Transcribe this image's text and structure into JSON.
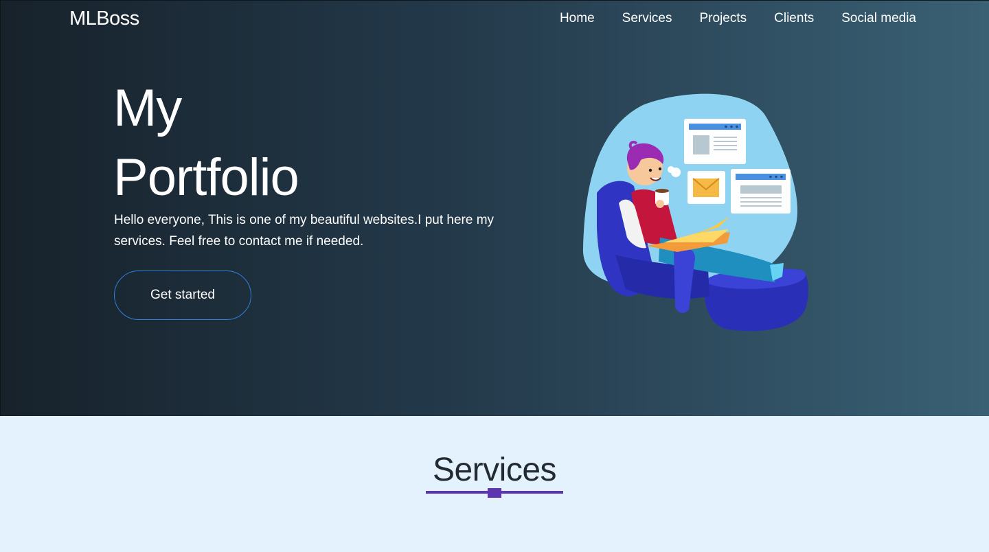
{
  "brand": "MLBoss",
  "nav": {
    "home": "Home",
    "services": "Services",
    "projects": "Projects",
    "clients": "Clients",
    "social": "Social media"
  },
  "hero": {
    "title_line1": "My",
    "title_line2": "Portfolio",
    "description": "Hello everyone, This is one of my beautiful websites.I put here my services. Feel free to contact me if needed.",
    "cta_label": "Get started"
  },
  "services": {
    "title": "Services"
  },
  "colors": {
    "accent_purple": "#5e35b1",
    "cta_border": "#2f80d8",
    "section_bg": "#e3f2fd"
  }
}
